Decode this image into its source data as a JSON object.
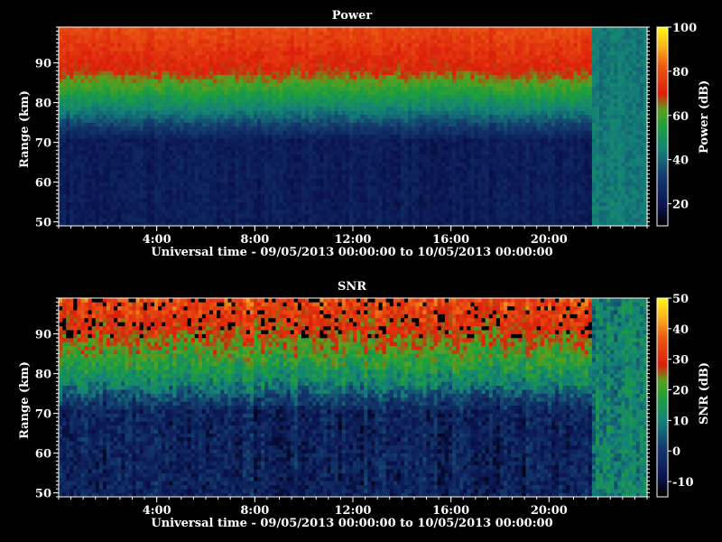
{
  "chart_data": [
    {
      "type": "heatmap",
      "title": "Power",
      "xlabel": "Universal time - 09/05/2013 00:00:00 to 10/05/2013 00:00:00",
      "ylabel": "Range (km)",
      "colorbar_label": "Power (dB)",
      "x_range_hours": [
        0,
        24
      ],
      "x_ticks": [
        4,
        8,
        12,
        16,
        20
      ],
      "x_tick_labels": [
        "4:00",
        "8:00",
        "12:00",
        "16:00",
        "20:00"
      ],
      "y_range_km": [
        49,
        99
      ],
      "y_ticks": [
        50,
        60,
        70,
        80,
        90
      ],
      "y_tick_labels": [
        "50",
        "60",
        "70",
        "80",
        "90"
      ],
      "colorbar_range": [
        10,
        100
      ],
      "colorbar_ticks": [
        20,
        40,
        60,
        80,
        100
      ],
      "colorbar_tick_labels": [
        "20",
        "40",
        "60",
        "80",
        "100"
      ],
      "field_description": {
        "low_range_level": 22,
        "mid_range_level": 45,
        "high_range_level": 70,
        "transition_range_km": [
          78,
          88
        ],
        "data_gap_after_hour": 21.6
      }
    },
    {
      "type": "heatmap",
      "title": "SNR",
      "xlabel": "Universal time - 09/05/2013 00:00:00 to 10/05/2013 00:00:00",
      "ylabel": "Range (km)",
      "colorbar_label": "SNR (dB)",
      "x_range_hours": [
        0,
        24
      ],
      "x_ticks": [
        4,
        8,
        12,
        16,
        20
      ],
      "x_tick_labels": [
        "4:00",
        "8:00",
        "12:00",
        "16:00",
        "20:00"
      ],
      "y_range_km": [
        49,
        99
      ],
      "y_ticks": [
        50,
        60,
        70,
        80,
        90
      ],
      "y_tick_labels": [
        "50",
        "60",
        "70",
        "80",
        "90"
      ],
      "colorbar_range": [
        -15,
        50
      ],
      "colorbar_ticks": [
        -10,
        0,
        10,
        20,
        30,
        40,
        50
      ],
      "colorbar_tick_labels": [
        "-10",
        "0",
        "10",
        "20",
        "30",
        "40",
        "50"
      ],
      "field_description": {
        "low_range_level": -5,
        "mid_range_level": 12,
        "high_range_level": 28,
        "transition_range_km": [
          78,
          90
        ],
        "data_gap_after_hour": 21.6
      }
    }
  ]
}
